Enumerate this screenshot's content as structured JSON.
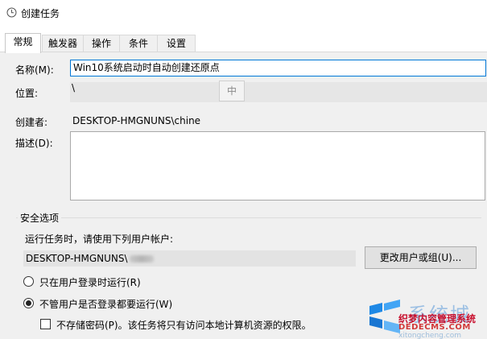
{
  "window": {
    "title": "创建任务",
    "icon": "clock-icon"
  },
  "tabs": [
    {
      "label": "常规",
      "active": true
    },
    {
      "label": "触发器",
      "active": false
    },
    {
      "label": "操作",
      "active": false
    },
    {
      "label": "条件",
      "active": false
    },
    {
      "label": "设置",
      "active": false
    }
  ],
  "general": {
    "name_label": "名称(M):",
    "name_value": "Win10系统启动时自动创建还原点",
    "location_label": "位置:",
    "location_value": "\\",
    "ime_indicator": "中",
    "author_label": "创建者:",
    "author_value": "DESKTOP-HMGNUNS\\chine",
    "description_label": "描述(D):",
    "description_value": ""
  },
  "security": {
    "group_title": "安全选项",
    "run_as_prompt": "运行任务时，请使用下列用户帐户:",
    "account_value": "DESKTOP-HMGNUNS\\",
    "change_button": "更改用户或组(U)...",
    "radio_logged_on": "只在用户登录时运行(R)",
    "radio_always": "不管用户是否登录都要运行(W)",
    "selected_radio": "always",
    "no_store_password_label": "不存储密码(P)。该任务将只有访问本地计算机资源的权限。",
    "no_store_password_checked": false
  },
  "watermark": {
    "big_text": "系统城",
    "brand": "织梦内容管理系统",
    "domain": "DEDECMS.COM",
    "url": "xitongcheng.com"
  }
}
